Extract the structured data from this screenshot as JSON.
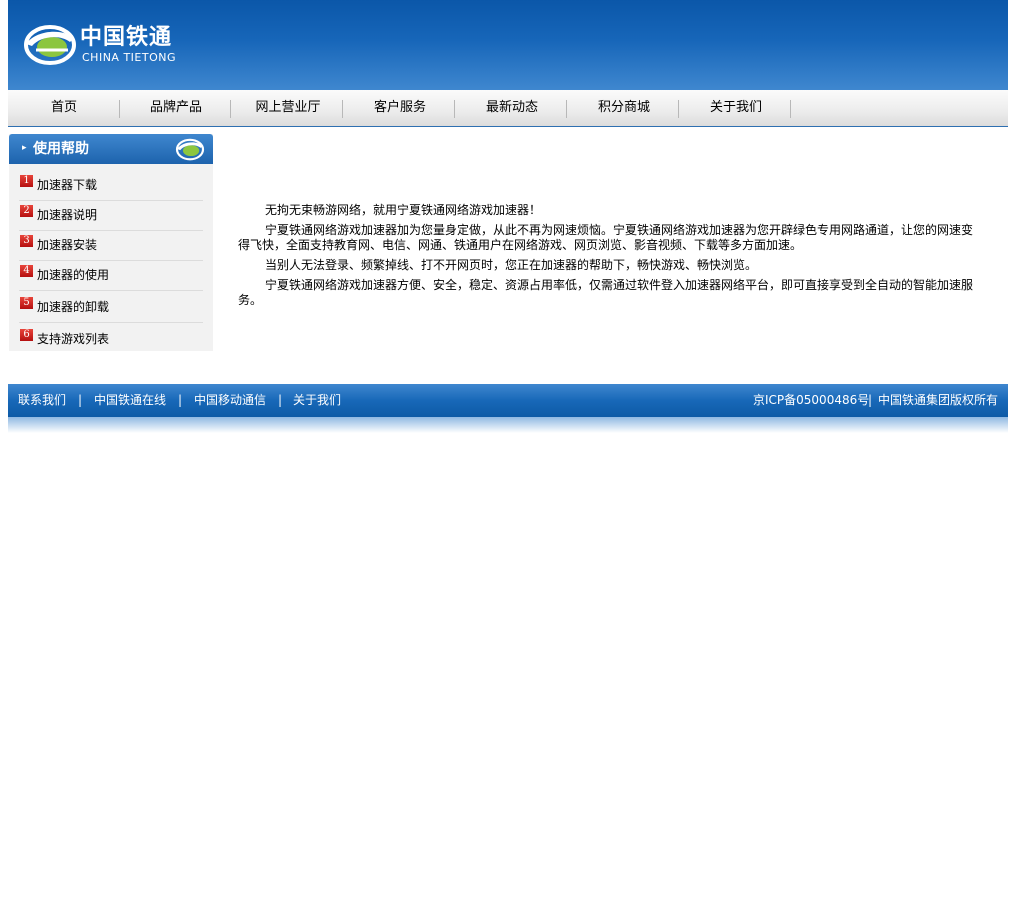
{
  "header": {
    "logo_cn": "中国铁通",
    "logo_en": "CHINA TIETONG"
  },
  "nav": {
    "items": [
      "首页",
      "品牌产品",
      "网上营业厅",
      "客户服务",
      "最新动态",
      "积分商城",
      "关于我们"
    ]
  },
  "sidebar": {
    "title": "使用帮助",
    "items": [
      {
        "num": "1",
        "label": "加速器下载"
      },
      {
        "num": "2",
        "label": "加速器说明"
      },
      {
        "num": "3",
        "label": "加速器安装"
      },
      {
        "num": "4",
        "label": "加速器的使用"
      },
      {
        "num": "5",
        "label": "加速器的卸载"
      },
      {
        "num": "6",
        "label": "支持游戏列表"
      }
    ]
  },
  "content": {
    "paragraphs": [
      "无拘无束畅游网络，就用宁夏铁通网络游戏加速器！",
      "宁夏铁通网络游戏加速器加为您量身定做，从此不再为网速烦恼。宁夏铁通网络游戏加速器为您开辟绿色专用网路通道，让您的网速变得飞快，全面支持教育网、电信、网通、铁通用户在网络游戏、网页浏览、影音视频、下载等多方面加速。",
      "当别人无法登录、频繁掉线、打不开网页时，您正在加速器的帮助下，畅快游戏、畅快浏览。",
      "宁夏铁通网络游戏加速器方便、安全，稳定、资源占用率低，仅需通过软件登入加速器网络平台，即可直接享受到全自动的智能加速服务。"
    ]
  },
  "footer": {
    "links": [
      "联系我们",
      "中国铁通在线",
      "中国移动通信",
      "关于我们"
    ],
    "separator": "|",
    "icp": "京ICP备05000486号",
    "copyright_sep": "|",
    "copyright": "中国铁通集团版权所有"
  },
  "colors": {
    "brand_blue": "#0b57a9",
    "accent_green": "#7ab648",
    "badge_red": "#c8201a"
  },
  "icons": {
    "logo_mark": "china-tietong-logo-icon",
    "side_arrow": "arrow-right-icon",
    "side_mark": "china-tietong-logo-icon"
  }
}
